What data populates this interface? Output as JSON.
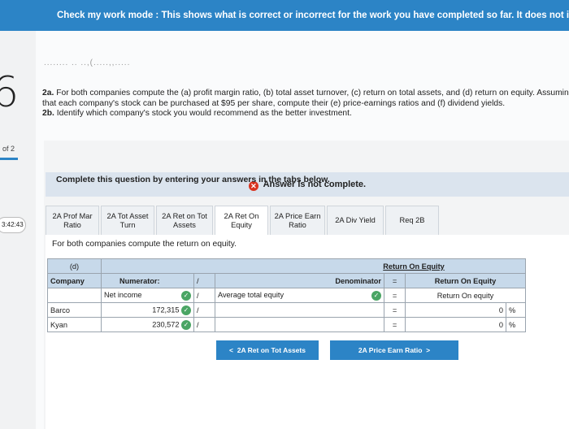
{
  "banner": {
    "text": "Check my work mode : This shows what is correct or incorrect for the work you have completed so far. It does not indicate completion."
  },
  "sidebar": {
    "question_number": "6",
    "of_label": "of 2",
    "timer": "3:42:43"
  },
  "problem": {
    "ghost_text": "........ .. ..,(.....,,.....",
    "part_a_label": "2a.",
    "part_a_text": "For both companies compute the (a) profit margin ratio, (b) total asset turnover, (c) return on total assets, and (d) return on equity. Assuming that each company's stock can be purchased at $95 per share, compute their (e) price-earnings ratios and (f) dividend yields.",
    "part_b_label": "2b.",
    "part_b_text": "Identify which company's stock you would recommend as the better investment."
  },
  "status": {
    "text": "Answer is not complete."
  },
  "instructions": {
    "complete": "Complete this question by entering your answers in the tabs below."
  },
  "tabs": [
    {
      "line1": "2A Prof Mar",
      "line2": "Ratio"
    },
    {
      "line1": "2A Tot Asset",
      "line2": "Turn"
    },
    {
      "line1": "2A Ret on Tot",
      "line2": "Assets"
    },
    {
      "line1": "2A Ret On",
      "line2": "Equity"
    },
    {
      "line1": "2A Price Earn",
      "line2": "Ratio"
    },
    {
      "line1": "2A Div Yield",
      "line2": ""
    },
    {
      "line1": "Req 2B",
      "line2": ""
    }
  ],
  "content": {
    "instruction": "For both companies compute the return on equity.",
    "table": {
      "part_label": "(d)",
      "title": "Return On Equity",
      "company_header": "Company",
      "numerator_header": "Numerator:",
      "slash": "/",
      "denominator_header": "Denominator",
      "equals": "=",
      "result_header": "Return On Equity",
      "numerator_label": "Net income",
      "denominator_label": "Average total equity",
      "result_label": "Return On equity",
      "rows": [
        {
          "company": "Barco",
          "numerator": "172,315",
          "denominator": "",
          "result": "0",
          "unit": "%"
        },
        {
          "company": "Kyan",
          "numerator": "230,572",
          "denominator": "",
          "result": "0",
          "unit": "%"
        }
      ]
    }
  },
  "nav": {
    "prev_label": "2A Ret on Tot Assets",
    "next_label": "2A Price Earn Ratio"
  },
  "colors": {
    "accent": "#2c84c6",
    "header_fill": "#c7d9ea",
    "error": "#d9331f",
    "check": "#4aa564"
  }
}
